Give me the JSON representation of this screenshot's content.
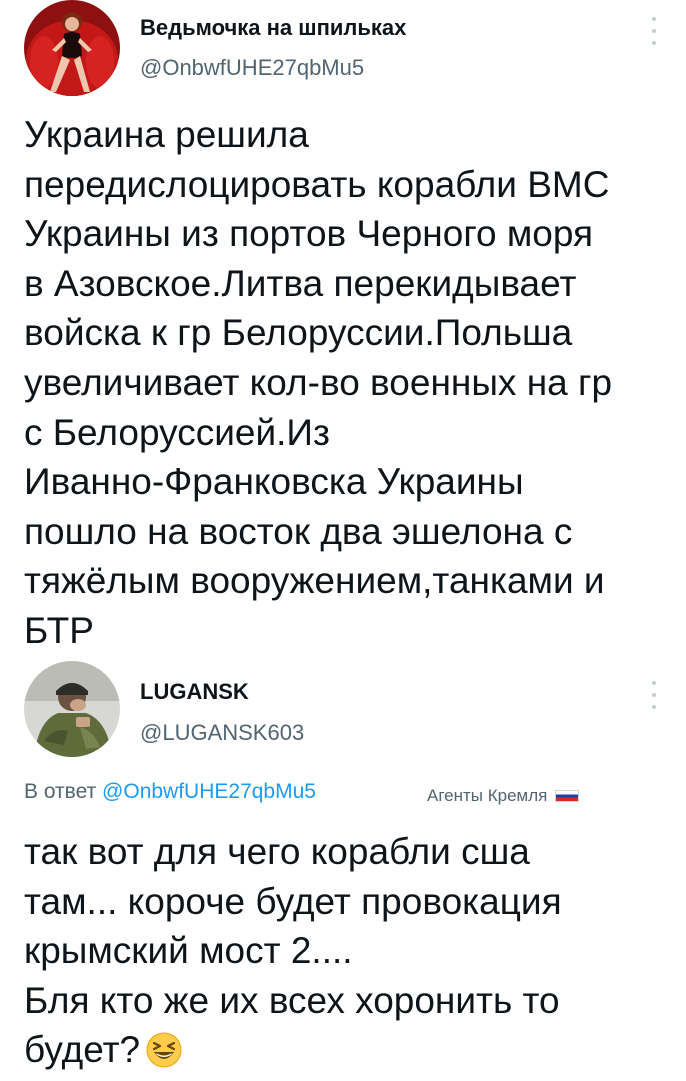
{
  "tweet1": {
    "display_name": "Ведьмочка на шпильках",
    "handle": "@OnbwfUHE27qbMu5",
    "avatar_icon": "woman-red-armchair-avatar",
    "more_icon": "vertical-ellipsis-icon",
    "text": "Украина решила\nпередислоцировать корабли ВМС\nУкраины из портов Черного моря\nв Азовское.Литва перекидывает\nвойска к гр Белоруссии.Польша\nувеличивает кол-во военных на гр\nс Белоруссией.Из\nИванно-Франковска Украины\nпошло на восток два эшелона с\nтяжёлым вооружением,танками и\nБТР"
  },
  "tweet2": {
    "display_name": "LUGANSK",
    "handle": "@LUGANSK603",
    "avatar_icon": "soldier-avatar",
    "more_icon": "vertical-ellipsis-icon",
    "reply_prefix": "В ответ",
    "reply_to": "@OnbwfUHE27qbMu5",
    "badge_text": "Агенты Кремля",
    "badge_icon": "russian-flag-icon",
    "text": "так вот для чего корабли сша\nтам... короче будет провокация\nкрымский мост 2....\nБля кто же их всех хоронить то\nбудет?",
    "emoji_icon": "grinning-squinting-face-icon"
  }
}
